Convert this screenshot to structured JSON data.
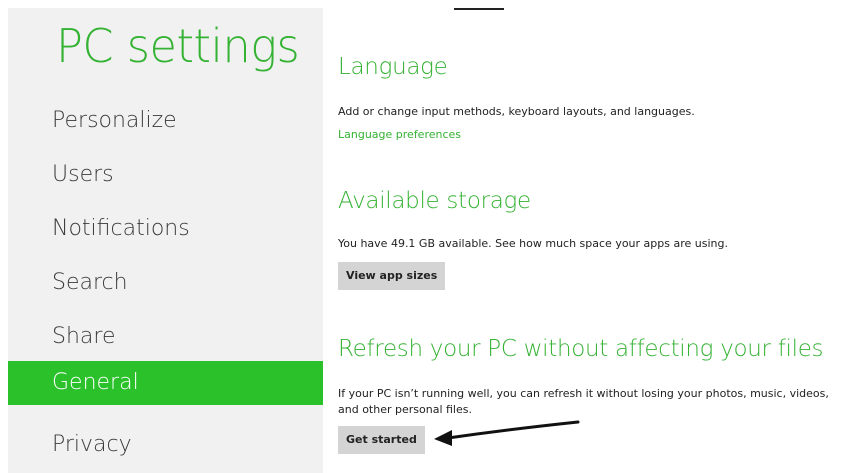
{
  "app": {
    "title": "PC settings"
  },
  "nav": {
    "items": [
      {
        "label": "Personalize",
        "selected": false
      },
      {
        "label": "Users",
        "selected": false
      },
      {
        "label": "Notifications",
        "selected": false
      },
      {
        "label": "Search",
        "selected": false
      },
      {
        "label": "Share",
        "selected": false
      },
      {
        "label": "General",
        "selected": true
      },
      {
        "label": "Privacy",
        "selected": false
      }
    ]
  },
  "content": {
    "language": {
      "title": "Language",
      "description": "Add or change input methods, keyboard layouts, and languages.",
      "link": "Language preferences"
    },
    "storage": {
      "title": "Available storage",
      "description": "You have 49.1 GB available. See how much space your apps are using.",
      "button": "View app sizes"
    },
    "refresh": {
      "title": "Refresh your PC without affecting your files",
      "description": "If your PC isn’t running well, you can refresh it without losing your photos, music, videos, and other personal files.",
      "button": "Get started"
    }
  },
  "colors": {
    "accent": "#34b233",
    "selected_bg": "#2bc12b",
    "nav_bg": "#f1f1f1",
    "button_bg": "#d4d4d4"
  },
  "annotation": {
    "arrow_icon": "arrow-left-icon"
  }
}
